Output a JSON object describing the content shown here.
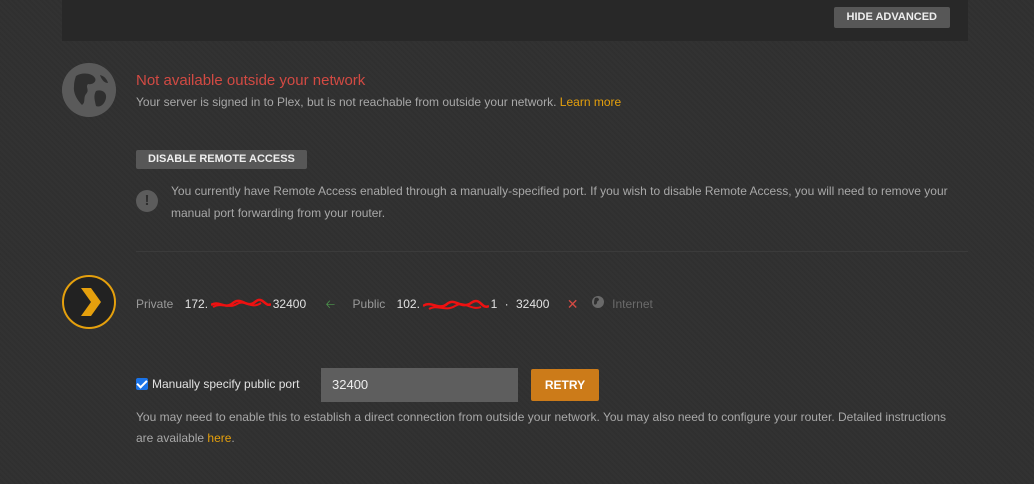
{
  "header": {
    "hide_advanced_label": "HIDE ADVANCED"
  },
  "status": {
    "title": "Not available outside your network",
    "description": "Your server is signed in to Plex, but is not reachable from outside your network.",
    "learn_more": "Learn more"
  },
  "remote": {
    "disable_label": "DISABLE REMOTE ACCESS",
    "warning_text": "You currently have Remote Access enabled through a manually-specified port. If you wish to disable Remote Access, you will need to remove your manual port forwarding from your router."
  },
  "network": {
    "private_label": "Private",
    "private_ip_prefix": "172.",
    "private_port": "32400",
    "public_label": "Public",
    "public_ip_prefix": "102.",
    "public_ip_tail": "1",
    "public_port": "32400",
    "internet_label": "Internet"
  },
  "manual_port": {
    "checkbox_label": "Manually specify public port",
    "checked": true,
    "port_value": "32400",
    "retry_label": "RETRY",
    "help_text": "You may need to enable this to establish a direct connection from outside your network. You may also need to configure your router. Detailed instructions are available",
    "here_link": "here",
    "period": "."
  },
  "colors": {
    "accent": "#e5a00d",
    "error": "#d24a43",
    "retry": "#cc7b19",
    "ok_arrow": "#4e9b4e"
  },
  "icons": [
    "globe-icon",
    "alert-icon",
    "plex-chevron-icon",
    "arrow-left-icon",
    "x-icon",
    "globe-small-icon",
    "checkbox-checked-icon"
  ]
}
